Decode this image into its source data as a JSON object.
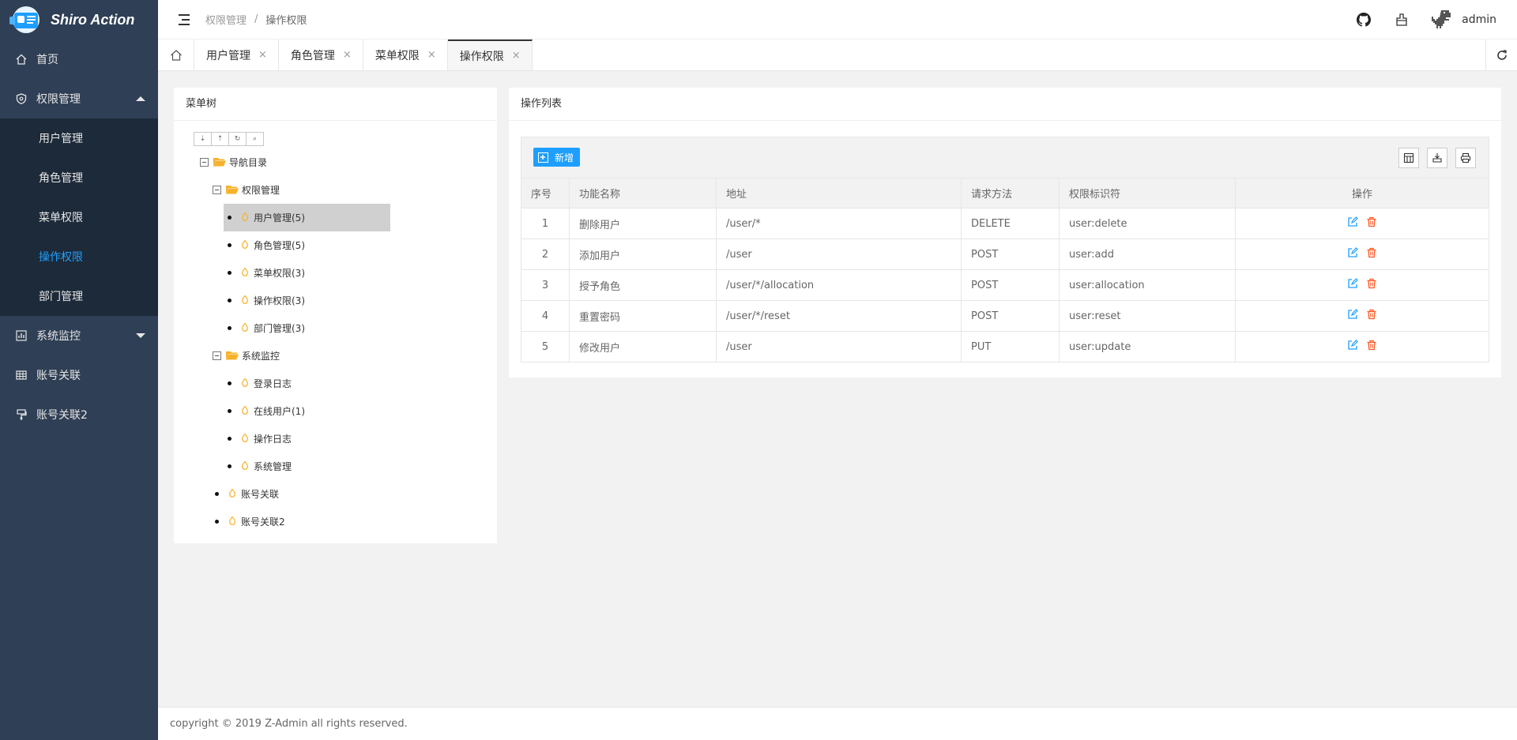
{
  "app": {
    "title": "Shiro Action"
  },
  "sidebar": {
    "items": [
      {
        "label": "首页",
        "icon": "home-icon"
      },
      {
        "label": "权限管理",
        "icon": "shield-icon",
        "expanded": true,
        "children": [
          "用户管理",
          "角色管理",
          "菜单权限",
          "操作权限",
          "部门管理"
        ],
        "active_child": "操作权限"
      },
      {
        "label": "系统监控",
        "icon": "chart-icon",
        "expanded": false
      },
      {
        "label": "账号关联",
        "icon": "table-icon"
      },
      {
        "label": "账号关联2",
        "icon": "brush-icon"
      }
    ]
  },
  "header": {
    "breadcrumb": [
      "权限管理",
      "操作权限"
    ],
    "separator": "/",
    "user": "admin"
  },
  "tabs": [
    {
      "label": "用户管理",
      "close": "×"
    },
    {
      "label": "角色管理",
      "close": "×"
    },
    {
      "label": "菜单权限",
      "close": "×"
    },
    {
      "label": "操作权限",
      "close": "×",
      "active": true
    }
  ],
  "tree_panel": {
    "title": "菜单树",
    "nodes": {
      "root": "导航目录",
      "perm": "权限管理",
      "perm_user": "用户管理(5)",
      "perm_role": "角色管理(5)",
      "perm_menu": "菜单权限(3)",
      "perm_op": "操作权限(3)",
      "perm_dept": "部门管理(3)",
      "monitor": "系统监控",
      "mon_login": "登录日志",
      "mon_online": "在线用户(1)",
      "mon_op": "操作日志",
      "mon_sys": "系统管理",
      "acct": "账号关联",
      "acct2": "账号关联2"
    }
  },
  "list_panel": {
    "title": "操作列表",
    "add_label": "新增",
    "columns": [
      "序号",
      "功能名称",
      "地址",
      "请求方法",
      "权限标识符",
      "操作"
    ],
    "rows": [
      [
        "1",
        "删除用户",
        "/user/*",
        "DELETE",
        "user:delete"
      ],
      [
        "2",
        "添加用户",
        "/user",
        "POST",
        "user:add"
      ],
      [
        "3",
        "授予角色",
        "/user/*/allocation",
        "POST",
        "user:allocation"
      ],
      [
        "4",
        "重置密码",
        "/user/*/reset",
        "POST",
        "user:reset"
      ],
      [
        "5",
        "修改用户",
        "/user",
        "PUT",
        "user:update"
      ]
    ]
  },
  "footer": {
    "text": "copyright © 2019 Z-Admin all rights reserved."
  },
  "colors": {
    "sidebar": "#2f3f55",
    "sidebar_sub": "#1d2a3a",
    "accent": "#1e9fff",
    "danger": "#ff5722",
    "folder": "#f7b12b"
  }
}
